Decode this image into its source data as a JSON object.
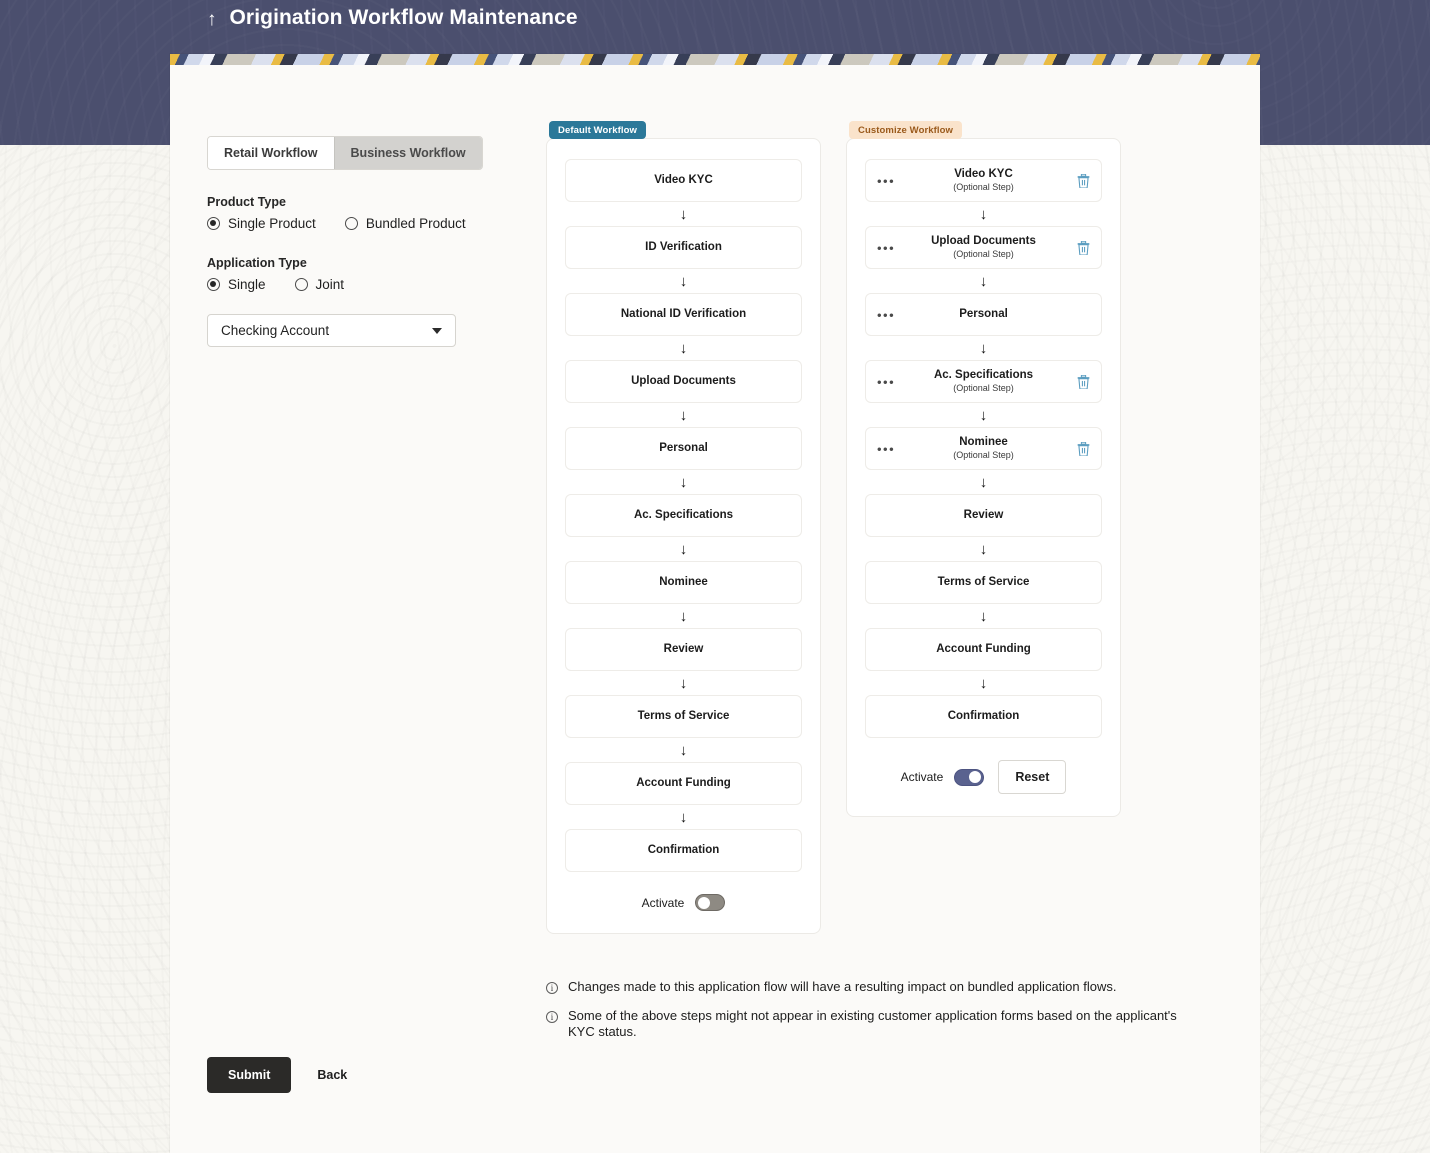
{
  "header": {
    "back_arrow": "↑",
    "title": "Origination Workflow Maintenance"
  },
  "colors": {
    "header_band": "#4b4f6e",
    "badge_default_bg": "#2b7899",
    "badge_customize_bg": "#fae3cb",
    "badge_customize_text": "#9a5a1c",
    "toggle_on": "#5a628f",
    "toggle_off": "#8e8a83",
    "submit_bg": "#2b2a28",
    "delete_icon": "#5b9dc0"
  },
  "left_panel": {
    "segmented": {
      "retail_label": "Retail Workflow",
      "business_label": "Business Workflow",
      "active": "Retail Workflow"
    },
    "product_type": {
      "label": "Product Type",
      "options": [
        {
          "label": "Single Product",
          "checked": true
        },
        {
          "label": "Bundled Product",
          "checked": false
        }
      ]
    },
    "application_type": {
      "label": "Application Type",
      "options": [
        {
          "label": "Single",
          "checked": true
        },
        {
          "label": "Joint",
          "checked": false
        }
      ]
    },
    "account_select": {
      "value": "Checking Account",
      "caret": "caret-down-icon"
    }
  },
  "default_workflow": {
    "badge": "Default Workflow",
    "arrow_glyph": "↓",
    "steps": [
      {
        "label": "Video KYC"
      },
      {
        "label": "ID Verification"
      },
      {
        "label": "National ID Verification"
      },
      {
        "label": "Upload Documents"
      },
      {
        "label": "Personal"
      },
      {
        "label": "Ac. Specifications"
      },
      {
        "label": "Nominee"
      },
      {
        "label": "Review"
      },
      {
        "label": "Terms of Service"
      },
      {
        "label": "Account Funding"
      },
      {
        "label": "Confirmation"
      }
    ],
    "activate": {
      "label": "Activate",
      "state": "off"
    }
  },
  "customize_workflow": {
    "badge": "Customize Workflow",
    "arrow_glyph": "↓",
    "drag_handle": "•••",
    "optional_tag": "(Optional Step)",
    "steps": [
      {
        "label": "Video KYC",
        "sub": "(Optional Step)",
        "draggable": true,
        "deletable": true
      },
      {
        "label": "Upload Documents",
        "sub": "(Optional Step)",
        "draggable": true,
        "deletable": true
      },
      {
        "label": "Personal",
        "sub": "",
        "draggable": true,
        "deletable": false
      },
      {
        "label": "Ac. Specifications",
        "sub": "(Optional Step)",
        "draggable": true,
        "deletable": true
      },
      {
        "label": "Nominee",
        "sub": "(Optional Step)",
        "draggable": true,
        "deletable": true
      },
      {
        "label": "Review",
        "sub": "",
        "draggable": false,
        "deletable": false
      },
      {
        "label": "Terms of Service",
        "sub": "",
        "draggable": false,
        "deletable": false
      },
      {
        "label": "Account Funding",
        "sub": "",
        "draggable": false,
        "deletable": false
      },
      {
        "label": "Confirmation",
        "sub": "",
        "draggable": false,
        "deletable": false
      }
    ],
    "activate": {
      "label": "Activate",
      "state": "on"
    },
    "reset_label": "Reset"
  },
  "notes": [
    "Changes made to this application flow will have a resulting impact on bundled application flows.",
    "Some of the above steps might not appear in existing customer application forms based on the applicant's KYC status."
  ],
  "footer": {
    "submit_label": "Submit",
    "back_label": "Back"
  }
}
